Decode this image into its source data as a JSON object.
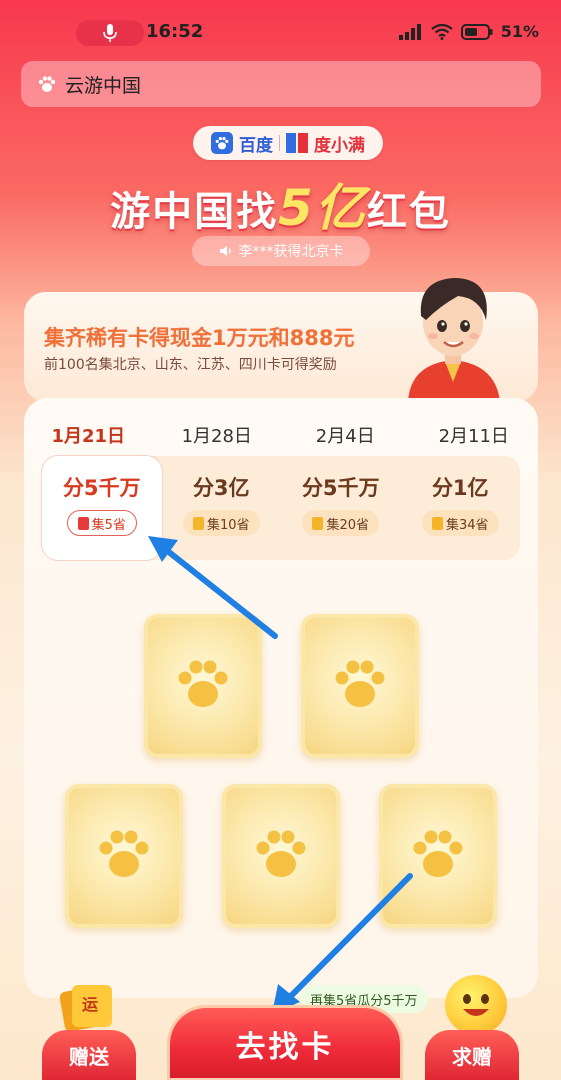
{
  "status_bar": {
    "time": "16:52",
    "battery": "51%"
  },
  "search": {
    "query": "云游中国"
  },
  "brand": {
    "baidu": "百度",
    "duxiaoman": "度小满"
  },
  "headline": {
    "prefix": "游中国找",
    "highlight": "5亿",
    "suffix": "红包"
  },
  "ticker": {
    "text": "李***获得北京卡"
  },
  "reward": {
    "title": "集齐稀有卡得现金1万元和888元",
    "subtitle": "前100名集北京、山东、江苏、四川卡可得奖励"
  },
  "dates": [
    "1月21日",
    "1月28日",
    "2月4日",
    "2月11日"
  ],
  "active_date_index": 0,
  "prizes": [
    {
      "amount": "分5千万",
      "tag": "集5省"
    },
    {
      "amount": "分3亿",
      "tag": "集10省"
    },
    {
      "amount": "分5千万",
      "tag": "集20省"
    },
    {
      "amount": "分1亿",
      "tag": "集34省"
    }
  ],
  "bottom": {
    "gift_badge": "运",
    "gift_label": "赠送",
    "main_label": "去找卡",
    "ask_label": "求赠",
    "bubble": "再集5省瓜分5千万"
  },
  "colors": {
    "accent_red": "#ee2a38",
    "gold": "#f6d37c",
    "arrow_blue": "#1f7fe3"
  }
}
